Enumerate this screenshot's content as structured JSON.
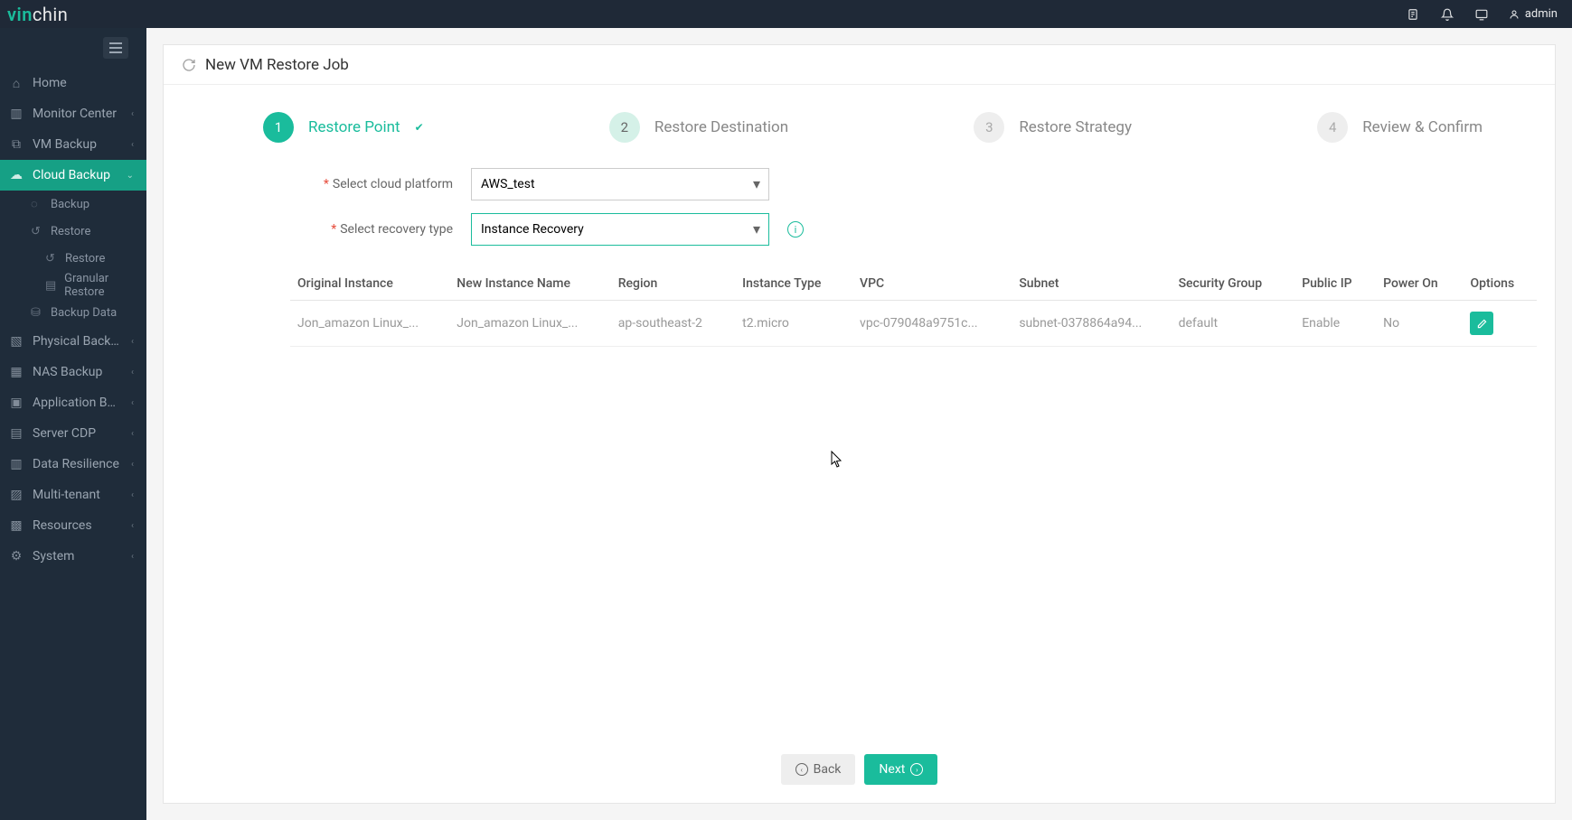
{
  "brand": {
    "part1": "vin",
    "part2": "chin"
  },
  "topbar": {
    "user": "admin"
  },
  "sidebar": {
    "items": [
      {
        "label": "Home"
      },
      {
        "label": "Monitor Center"
      },
      {
        "label": "VM Backup"
      },
      {
        "label": "Cloud Backup"
      },
      {
        "label": "Physical Backup"
      },
      {
        "label": "NAS Backup"
      },
      {
        "label": "Application Backup"
      },
      {
        "label": "Server CDP"
      },
      {
        "label": "Data Resilience"
      },
      {
        "label": "Multi-tenant"
      },
      {
        "label": "Resources"
      },
      {
        "label": "System"
      }
    ],
    "cloud_backup_sub": [
      {
        "label": "Backup"
      },
      {
        "label": "Restore"
      },
      {
        "label": "Restore"
      },
      {
        "label": "Granular Restore"
      },
      {
        "label": "Backup Data"
      }
    ]
  },
  "page": {
    "title": "New VM Restore Job",
    "steps": [
      {
        "num": "1",
        "label": "Restore Point"
      },
      {
        "num": "2",
        "label": "Restore Destination"
      },
      {
        "num": "3",
        "label": "Restore Strategy"
      },
      {
        "num": "4",
        "label": "Review & Confirm"
      }
    ],
    "form": {
      "platform_label": "Select cloud platform",
      "platform_value": "AWS_test",
      "recovery_label": "Select recovery type",
      "recovery_value": "Instance Recovery"
    },
    "table": {
      "headers": [
        "Original Instance",
        "New Instance Name",
        "Region",
        "Instance Type",
        "VPC",
        "Subnet",
        "Security Group",
        "Public IP",
        "Power On",
        "Options"
      ],
      "rows": [
        {
          "original": "Jon_amazon Linux_...",
          "newname": "Jon_amazon Linux_...",
          "region": "ap-southeast-2",
          "itype": "t2.micro",
          "vpc": "vpc-079048a9751c...",
          "subnet": "subnet-0378864a94...",
          "sg": "default",
          "pubip": "Enable",
          "poweron": "No"
        }
      ]
    },
    "buttons": {
      "back": "Back",
      "next": "Next"
    }
  }
}
